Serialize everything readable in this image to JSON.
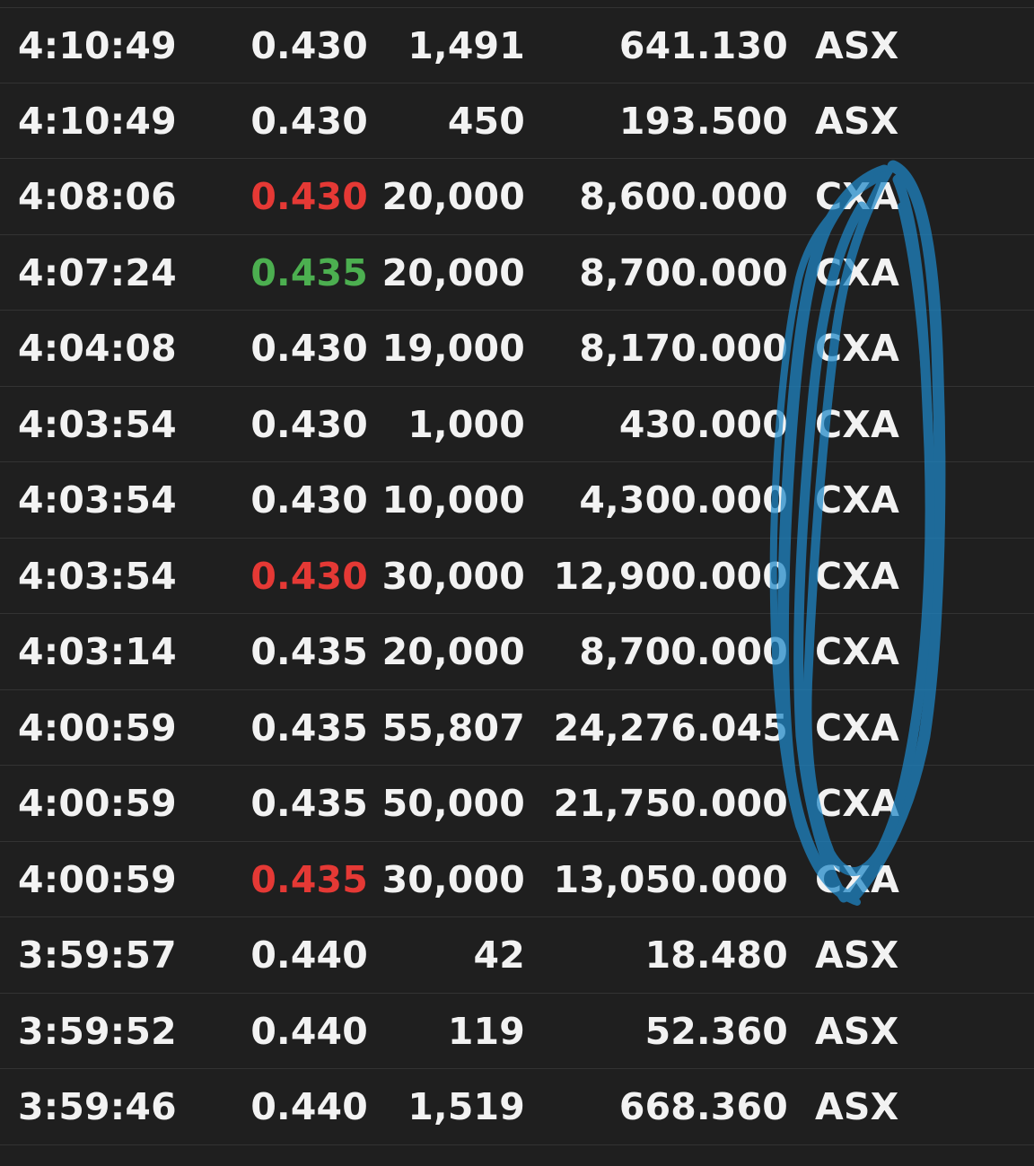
{
  "trades": [
    {
      "time": "4:10:49",
      "price": "0.430",
      "volume": "1,491",
      "value": "641.130",
      "market": "ASX",
      "price_color": "neutral"
    },
    {
      "time": "4:10:49",
      "price": "0.430",
      "volume": "450",
      "value": "193.500",
      "market": "ASX",
      "price_color": "neutral"
    },
    {
      "time": "4:08:06",
      "price": "0.430",
      "volume": "20,000",
      "value": "8,600.000",
      "market": "CXA",
      "price_color": "down"
    },
    {
      "time": "4:07:24",
      "price": "0.435",
      "volume": "20,000",
      "value": "8,700.000",
      "market": "CXA",
      "price_color": "up"
    },
    {
      "time": "4:04:08",
      "price": "0.430",
      "volume": "19,000",
      "value": "8,170.000",
      "market": "CXA",
      "price_color": "neutral"
    },
    {
      "time": "4:03:54",
      "price": "0.430",
      "volume": "1,000",
      "value": "430.000",
      "market": "CXA",
      "price_color": "neutral"
    },
    {
      "time": "4:03:54",
      "price": "0.430",
      "volume": "10,000",
      "value": "4,300.000",
      "market": "CXA",
      "price_color": "neutral"
    },
    {
      "time": "4:03:54",
      "price": "0.430",
      "volume": "30,000",
      "value": "12,900.000",
      "market": "CXA",
      "price_color": "down"
    },
    {
      "time": "4:03:14",
      "price": "0.435",
      "volume": "20,000",
      "value": "8,700.000",
      "market": "CXA",
      "price_color": "neutral"
    },
    {
      "time": "4:00:59",
      "price": "0.435",
      "volume": "55,807",
      "value": "24,276.045",
      "market": "CXA",
      "price_color": "neutral"
    },
    {
      "time": "4:00:59",
      "price": "0.435",
      "volume": "50,000",
      "value": "21,750.000",
      "market": "CXA",
      "price_color": "neutral"
    },
    {
      "time": "4:00:59",
      "price": "0.435",
      "volume": "30,000",
      "value": "13,050.000",
      "market": "CXA",
      "price_color": "down"
    },
    {
      "time": "3:59:57",
      "price": "0.440",
      "volume": "42",
      "value": "18.480",
      "market": "ASX",
      "price_color": "neutral"
    },
    {
      "time": "3:59:52",
      "price": "0.440",
      "volume": "119",
      "value": "52.360",
      "market": "ASX",
      "price_color": "neutral"
    },
    {
      "time": "3:59:46",
      "price": "0.440",
      "volume": "1,519",
      "value": "668.360",
      "market": "ASX",
      "price_color": "neutral"
    }
  ],
  "colors": {
    "background": "#1f1f1f",
    "text": "#f2f2f2",
    "up": "#4caf50",
    "down": "#e53935",
    "annotation": "#1e88c8"
  },
  "annotation": {
    "type": "hand-drawn loop",
    "color_name": "blue"
  }
}
